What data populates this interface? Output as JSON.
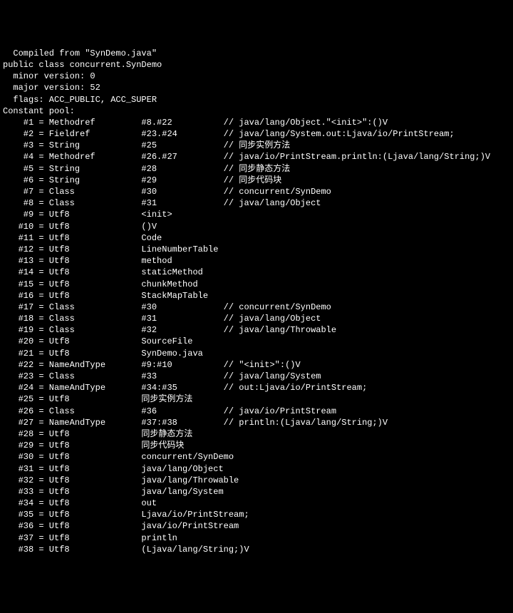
{
  "header": [
    "  Compiled from \"SynDemo.java\"",
    "public class concurrent.SynDemo",
    "  minor version: 0",
    "  major version: 52",
    "  flags: ACC_PUBLIC, ACC_SUPER",
    "Constant pool:"
  ],
  "pool": [
    {
      "idx": "#1",
      "kind": "Methodref",
      "value": "#8.#22",
      "comment": "// java/lang/Object.\"<init>\":()V"
    },
    {
      "idx": "#2",
      "kind": "Fieldref",
      "value": "#23.#24",
      "comment": "// java/lang/System.out:Ljava/io/PrintStream;"
    },
    {
      "idx": "#3",
      "kind": "String",
      "value": "#25",
      "comment": "// 同步实例方法"
    },
    {
      "idx": "#4",
      "kind": "Methodref",
      "value": "#26.#27",
      "comment": "// java/io/PrintStream.println:(Ljava/lang/String;)V"
    },
    {
      "idx": "#5",
      "kind": "String",
      "value": "#28",
      "comment": "// 同步静态方法"
    },
    {
      "idx": "#6",
      "kind": "String",
      "value": "#29",
      "comment": "// 同步代码块"
    },
    {
      "idx": "#7",
      "kind": "Class",
      "value": "#30",
      "comment": "// concurrent/SynDemo"
    },
    {
      "idx": "#8",
      "kind": "Class",
      "value": "#31",
      "comment": "// java/lang/Object"
    },
    {
      "idx": "#9",
      "kind": "Utf8",
      "value": "<init>",
      "comment": ""
    },
    {
      "idx": "#10",
      "kind": "Utf8",
      "value": "()V",
      "comment": ""
    },
    {
      "idx": "#11",
      "kind": "Utf8",
      "value": "Code",
      "comment": ""
    },
    {
      "idx": "#12",
      "kind": "Utf8",
      "value": "LineNumberTable",
      "comment": ""
    },
    {
      "idx": "#13",
      "kind": "Utf8",
      "value": "method",
      "comment": ""
    },
    {
      "idx": "#14",
      "kind": "Utf8",
      "value": "staticMethod",
      "comment": ""
    },
    {
      "idx": "#15",
      "kind": "Utf8",
      "value": "chunkMethod",
      "comment": ""
    },
    {
      "idx": "#16",
      "kind": "Utf8",
      "value": "StackMapTable",
      "comment": ""
    },
    {
      "idx": "#17",
      "kind": "Class",
      "value": "#30",
      "comment": "// concurrent/SynDemo"
    },
    {
      "idx": "#18",
      "kind": "Class",
      "value": "#31",
      "comment": "// java/lang/Object"
    },
    {
      "idx": "#19",
      "kind": "Class",
      "value": "#32",
      "comment": "// java/lang/Throwable"
    },
    {
      "idx": "#20",
      "kind": "Utf8",
      "value": "SourceFile",
      "comment": ""
    },
    {
      "idx": "#21",
      "kind": "Utf8",
      "value": "SynDemo.java",
      "comment": ""
    },
    {
      "idx": "#22",
      "kind": "NameAndType",
      "value": "#9:#10",
      "comment": "// \"<init>\":()V"
    },
    {
      "idx": "#23",
      "kind": "Class",
      "value": "#33",
      "comment": "// java/lang/System"
    },
    {
      "idx": "#24",
      "kind": "NameAndType",
      "value": "#34:#35",
      "comment": "// out:Ljava/io/PrintStream;"
    },
    {
      "idx": "#25",
      "kind": "Utf8",
      "value": "同步实例方法",
      "comment": ""
    },
    {
      "idx": "#26",
      "kind": "Class",
      "value": "#36",
      "comment": "// java/io/PrintStream"
    },
    {
      "idx": "#27",
      "kind": "NameAndType",
      "value": "#37:#38",
      "comment": "// println:(Ljava/lang/String;)V"
    },
    {
      "idx": "#28",
      "kind": "Utf8",
      "value": "同步静态方法",
      "comment": ""
    },
    {
      "idx": "#29",
      "kind": "Utf8",
      "value": "同步代码块",
      "comment": ""
    },
    {
      "idx": "#30",
      "kind": "Utf8",
      "value": "concurrent/SynDemo",
      "comment": ""
    },
    {
      "idx": "#31",
      "kind": "Utf8",
      "value": "java/lang/Object",
      "comment": ""
    },
    {
      "idx": "#32",
      "kind": "Utf8",
      "value": "java/lang/Throwable",
      "comment": ""
    },
    {
      "idx": "#33",
      "kind": "Utf8",
      "value": "java/lang/System",
      "comment": ""
    },
    {
      "idx": "#34",
      "kind": "Utf8",
      "value": "out",
      "comment": ""
    },
    {
      "idx": "#35",
      "kind": "Utf8",
      "value": "Ljava/io/PrintStream;",
      "comment": ""
    },
    {
      "idx": "#36",
      "kind": "Utf8",
      "value": "java/io/PrintStream",
      "comment": ""
    },
    {
      "idx": "#37",
      "kind": "Utf8",
      "value": "println",
      "comment": ""
    },
    {
      "idx": "#38",
      "kind": "Utf8",
      "value": "(Ljava/lang/String;)V",
      "comment": ""
    }
  ]
}
